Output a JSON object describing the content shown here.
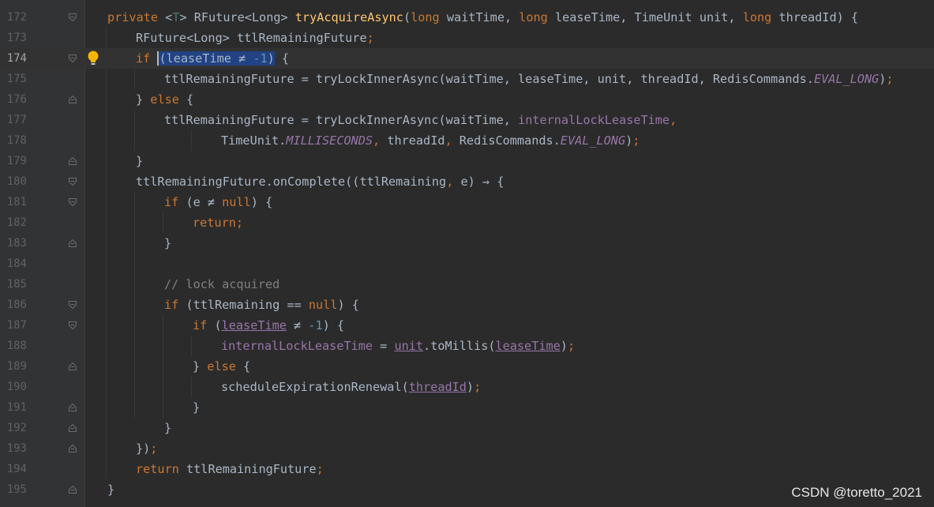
{
  "watermark": "CSDN @toretto_2021",
  "lines": [
    {
      "number": "172",
      "fold": "open",
      "indent": 0,
      "tokens": [
        [
          "kw",
          "private "
        ],
        [
          "plain",
          "<"
        ],
        [
          "tp",
          "T"
        ],
        [
          "plain",
          "> RFuture<Long> "
        ],
        [
          "fn",
          "tryAcquireAsync"
        ],
        [
          "plain",
          "("
        ],
        [
          "kw",
          "long "
        ],
        [
          "plain",
          "waitTime, "
        ],
        [
          "kw",
          "long "
        ],
        [
          "plain",
          "leaseTime, TimeUnit unit, "
        ],
        [
          "kw",
          "long "
        ],
        [
          "plain",
          "threadId) {"
        ]
      ]
    },
    {
      "number": "173",
      "indent": 1,
      "tokens": [
        [
          "plain",
          "RFuture<Long> ttlRemainingFuture"
        ],
        [
          "kw",
          ";"
        ]
      ]
    },
    {
      "number": "174",
      "fold": "open",
      "current": true,
      "bulb": true,
      "indent": 1,
      "tokens": [
        [
          "kw",
          "if "
        ],
        [
          "selcaret",
          "(leaseTime ≠ "
        ],
        [
          "selnum",
          "-1"
        ],
        [
          "sel",
          ")"
        ],
        [
          "plain",
          " {"
        ]
      ]
    },
    {
      "number": "175",
      "indent": 2,
      "tokens": [
        [
          "plain",
          "ttlRemainingFuture = tryLockInnerAsync(waitTime, leaseTime, unit, threadId, RedisCommands."
        ],
        [
          "sfld",
          "EVAL_LONG"
        ],
        [
          "plain",
          ")"
        ],
        [
          "kw",
          ";"
        ]
      ]
    },
    {
      "number": "176",
      "fold": "close",
      "indent": 1,
      "tokens": [
        [
          "plain",
          "} "
        ],
        [
          "kw",
          "else "
        ],
        [
          "plain",
          "{"
        ]
      ]
    },
    {
      "number": "177",
      "indent": 2,
      "tokens": [
        [
          "plain",
          "ttlRemainingFuture = tryLockInnerAsync(waitTime, "
        ],
        [
          "fld",
          "internalLockLeaseTime"
        ],
        [
          "kw",
          ","
        ]
      ]
    },
    {
      "number": "178",
      "indent": 4,
      "tokens": [
        [
          "plain",
          "TimeUnit."
        ],
        [
          "sfld",
          "MILLISECONDS"
        ],
        [
          "kw",
          ", "
        ],
        [
          "plain",
          "threadId"
        ],
        [
          "kw",
          ", "
        ],
        [
          "plain",
          "RedisCommands."
        ],
        [
          "sfld",
          "EVAL_LONG"
        ],
        [
          "plain",
          ")"
        ],
        [
          "kw",
          ";"
        ]
      ]
    },
    {
      "number": "179",
      "fold": "close",
      "indent": 1,
      "tokens": [
        [
          "plain",
          "}"
        ]
      ]
    },
    {
      "number": "180",
      "fold": "open",
      "indent": 1,
      "tokens": [
        [
          "plain",
          "ttlRemainingFuture.onComplete((ttlRemaining"
        ],
        [
          "kw",
          ", "
        ],
        [
          "plain",
          "e) → {"
        ]
      ]
    },
    {
      "number": "181",
      "fold": "open",
      "indent": 2,
      "tokens": [
        [
          "kw",
          "if "
        ],
        [
          "plain",
          "(e ≠ "
        ],
        [
          "kw",
          "null"
        ],
        [
          "plain",
          ") {"
        ]
      ]
    },
    {
      "number": "182",
      "indent": 3,
      "tokens": [
        [
          "kw",
          "return;"
        ]
      ]
    },
    {
      "number": "183",
      "fold": "close",
      "indent": 2,
      "tokens": [
        [
          "plain",
          "}"
        ]
      ]
    },
    {
      "number": "184",
      "indent": 0,
      "tokens": []
    },
    {
      "number": "185",
      "indent": 2,
      "tokens": [
        [
          "cm",
          "// lock acquired"
        ]
      ]
    },
    {
      "number": "186",
      "fold": "open",
      "indent": 2,
      "tokens": [
        [
          "kw",
          "if "
        ],
        [
          "plain",
          "(ttlRemaining == "
        ],
        [
          "kw",
          "null"
        ],
        [
          "plain",
          ") {"
        ]
      ]
    },
    {
      "number": "187",
      "fold": "open",
      "indent": 3,
      "tokens": [
        [
          "kw",
          "if "
        ],
        [
          "plain",
          "("
        ],
        [
          "ulfld",
          "leaseTime"
        ],
        [
          "plain",
          " ≠ "
        ],
        [
          "num",
          "-1"
        ],
        [
          "plain",
          ") {"
        ]
      ]
    },
    {
      "number": "188",
      "indent": 4,
      "tokens": [
        [
          "fld",
          "internalLockLeaseTime"
        ],
        [
          "plain",
          " = "
        ],
        [
          "ulfld",
          "unit"
        ],
        [
          "plain",
          ".toMillis("
        ],
        [
          "ulfld",
          "leaseTime"
        ],
        [
          "plain",
          ")"
        ],
        [
          "kw",
          ";"
        ]
      ]
    },
    {
      "number": "189",
      "fold": "close",
      "indent": 3,
      "tokens": [
        [
          "plain",
          "} "
        ],
        [
          "kw",
          "else "
        ],
        [
          "plain",
          "{"
        ]
      ]
    },
    {
      "number": "190",
      "indent": 4,
      "tokens": [
        [
          "plain",
          "scheduleExpirationRenewal("
        ],
        [
          "ulfld",
          "threadId"
        ],
        [
          "plain",
          ")"
        ],
        [
          "kw",
          ";"
        ]
      ]
    },
    {
      "number": "191",
      "fold": "close",
      "indent": 3,
      "tokens": [
        [
          "plain",
          "}"
        ]
      ]
    },
    {
      "number": "192",
      "fold": "close",
      "indent": 2,
      "tokens": [
        [
          "plain",
          "}"
        ]
      ]
    },
    {
      "number": "193",
      "fold": "close",
      "indent": 1,
      "tokens": [
        [
          "plain",
          "})"
        ],
        [
          "kw",
          ";"
        ]
      ]
    },
    {
      "number": "194",
      "indent": 1,
      "tokens": [
        [
          "kw",
          "return "
        ],
        [
          "plain",
          "ttlRemainingFuture"
        ],
        [
          "kw",
          ";"
        ]
      ]
    },
    {
      "number": "195",
      "fold": "close",
      "indent": 0,
      "tokens": [
        [
          "plain",
          "}"
        ]
      ]
    }
  ]
}
